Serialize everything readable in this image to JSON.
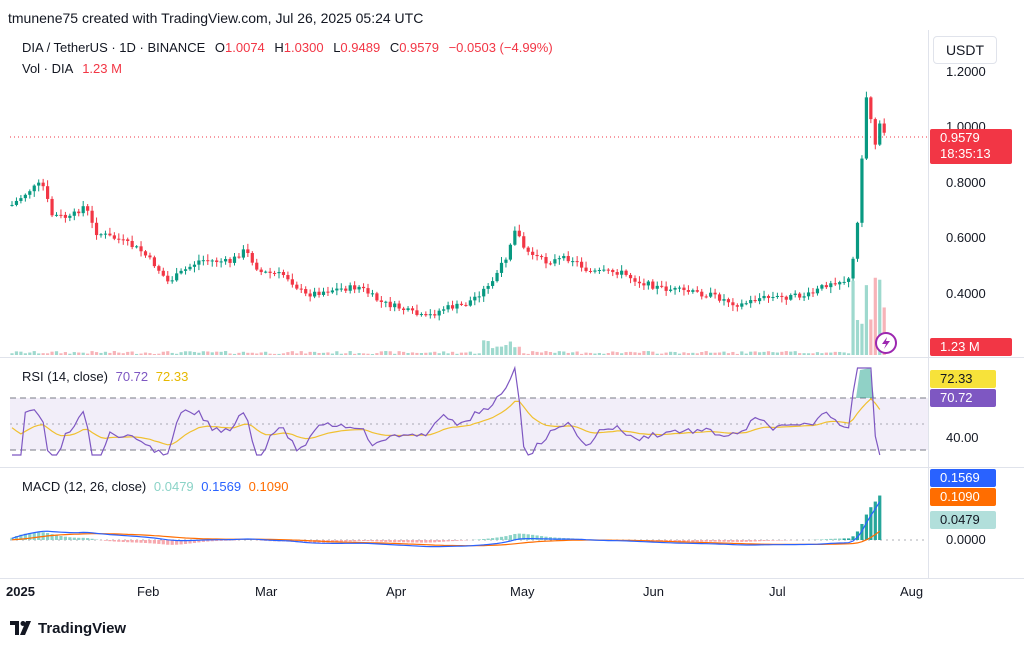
{
  "header": {
    "creator_line": "tmunene75 created with TradingView.com, Jul 26, 2025 05:24 UTC"
  },
  "symbol": {
    "name": "DIA / TetherUS · 1D · BINANCE",
    "o_label": "O",
    "o_value": "1.0074",
    "h_label": "H",
    "h_value": "1.0300",
    "l_label": "L",
    "l_value": "0.9489",
    "c_label": "C",
    "c_value": "0.9579",
    "change": "−0.0503 (−4.99%)"
  },
  "volume": {
    "label": "Vol · DIA",
    "value": "1.23 M",
    "tag": "1.23 M"
  },
  "currency_button": "USDT",
  "price_axis": {
    "ticks": [
      "1.2000",
      "1.0000",
      "0.8000",
      "0.6000",
      "0.4000"
    ]
  },
  "last_price": {
    "value": "0.9579",
    "countdown": "18:35:13"
  },
  "rsi": {
    "label": "RSI (14, close)",
    "value1": "70.72",
    "value2": "72.33",
    "tag1": "72.33",
    "tag2": "70.72",
    "tick": "40.00"
  },
  "macd": {
    "label": "MACD (12, 26, close)",
    "hist": "0.0479",
    "macd": "0.1569",
    "signal": "0.1090",
    "tag_macd": "0.1569",
    "tag_signal": "0.1090",
    "tag_hist": "0.0479",
    "tick": "0.0000"
  },
  "time_axis": [
    "2025",
    "Feb",
    "Mar",
    "Apr",
    "May",
    "Jun",
    "Jul",
    "Aug"
  ],
  "footer": {
    "brand": "TradingView"
  },
  "colors": {
    "up": "#089981",
    "down": "#f23645",
    "rsi_line": "#7e57c2",
    "rsi_ma": "#f0c030",
    "macd_line": "#2962ff",
    "signal_line": "#ff6d00"
  },
  "icons": {
    "flash": "lightning-icon"
  }
}
